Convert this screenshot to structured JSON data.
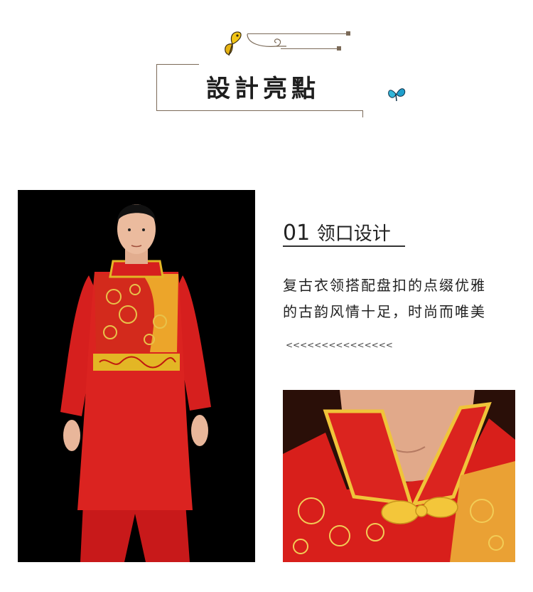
{
  "header": {
    "title": "設計亮點",
    "butterfly_left_icon": "yellow-butterfly-icon",
    "butterfly_right_icon": "blue-butterfly-icon"
  },
  "feature": {
    "number": "01",
    "title": "领口设计",
    "desc_line1": "复古衣领搭配盘扣的点缀优雅",
    "desc_line2": "的古韵风情十足，时尚而唯美",
    "arrows": "<<<<<<<<<<<<<<<"
  },
  "colors": {
    "garment_red": "#d9201e",
    "gold_trim": "#e6b820",
    "ornament_brown": "#7b6a58",
    "background": "#ffffff"
  }
}
